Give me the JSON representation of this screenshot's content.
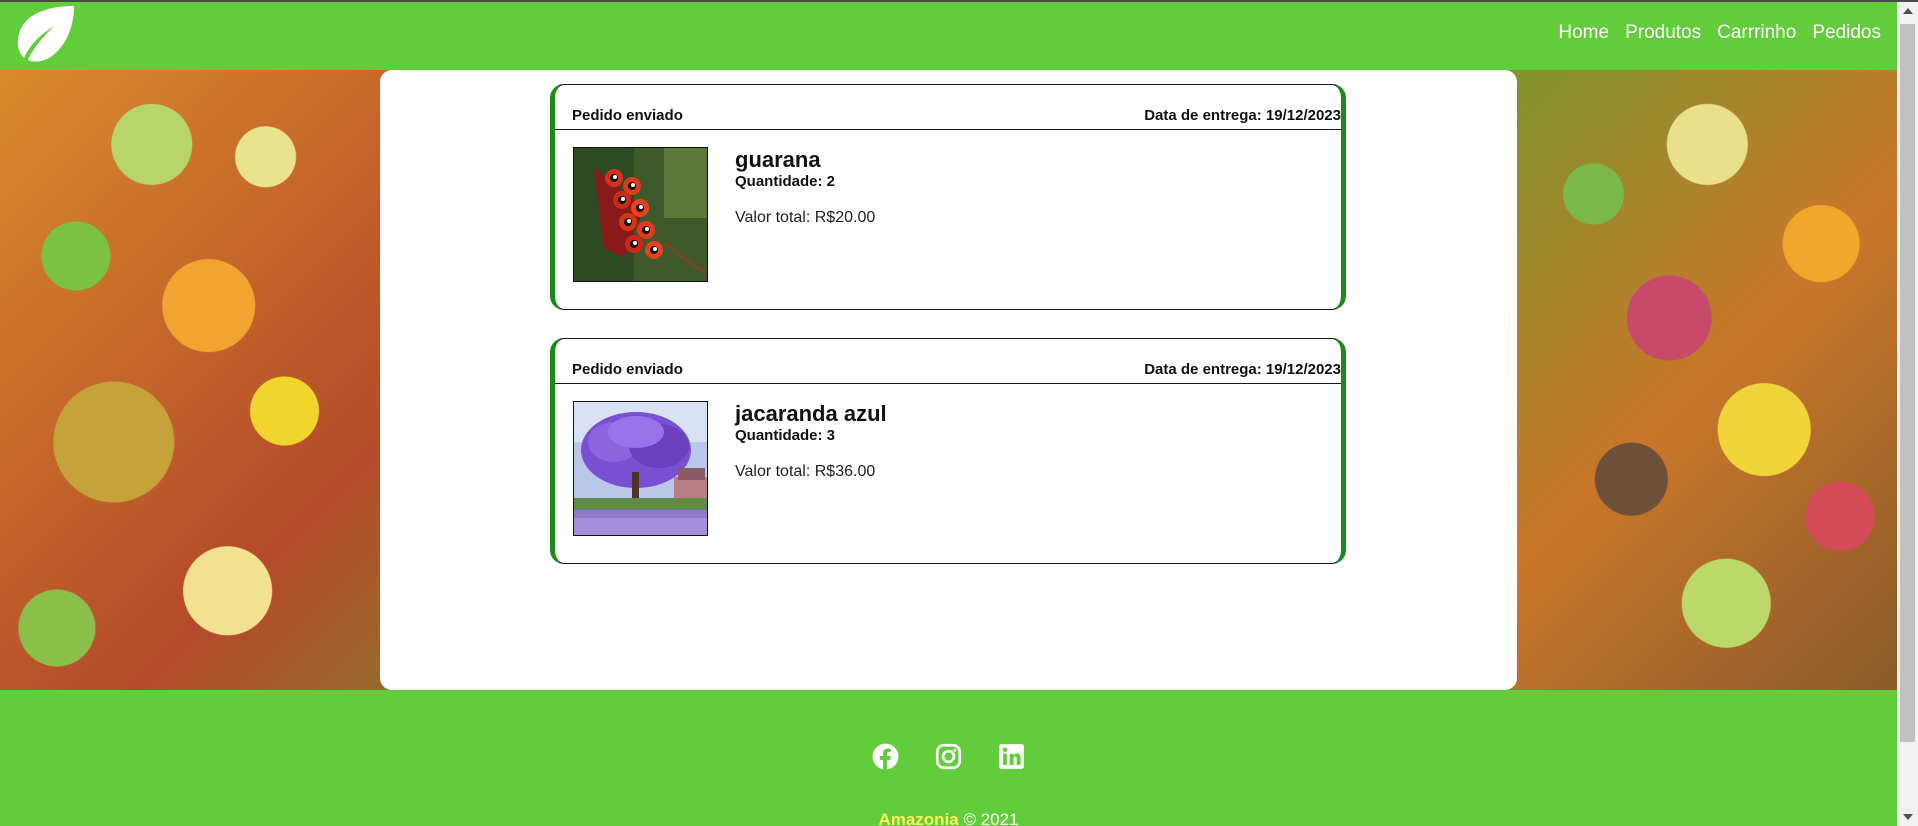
{
  "header": {
    "logo_icon": "leaf-icon",
    "nav": [
      "Home",
      "Produtos",
      "Carrrinho",
      "Pedidos"
    ]
  },
  "orders": [
    {
      "status": "Pedido enviado",
      "delivery": "Data de entrega: 19/12/2023",
      "product": "guarana",
      "quantity": "Quantidade: 2",
      "total": "Valor total: R$20.00"
    },
    {
      "status": "Pedido enviado",
      "delivery": "Data de entrega: 19/12/2023",
      "product": "jacaranda azul",
      "quantity": "Quantidade: 3",
      "total": "Valor total: R$36.00"
    }
  ],
  "footer": {
    "social_icons": [
      "facebook-icon",
      "instagram-icon",
      "linkedin-icon"
    ],
    "brand": "Amazonia",
    "copyright": " © 2021"
  },
  "colors": {
    "primary_green": "#62cd3a",
    "card_border_green": "#1a8a1a",
    "brand_yellow": "#fff45a"
  }
}
